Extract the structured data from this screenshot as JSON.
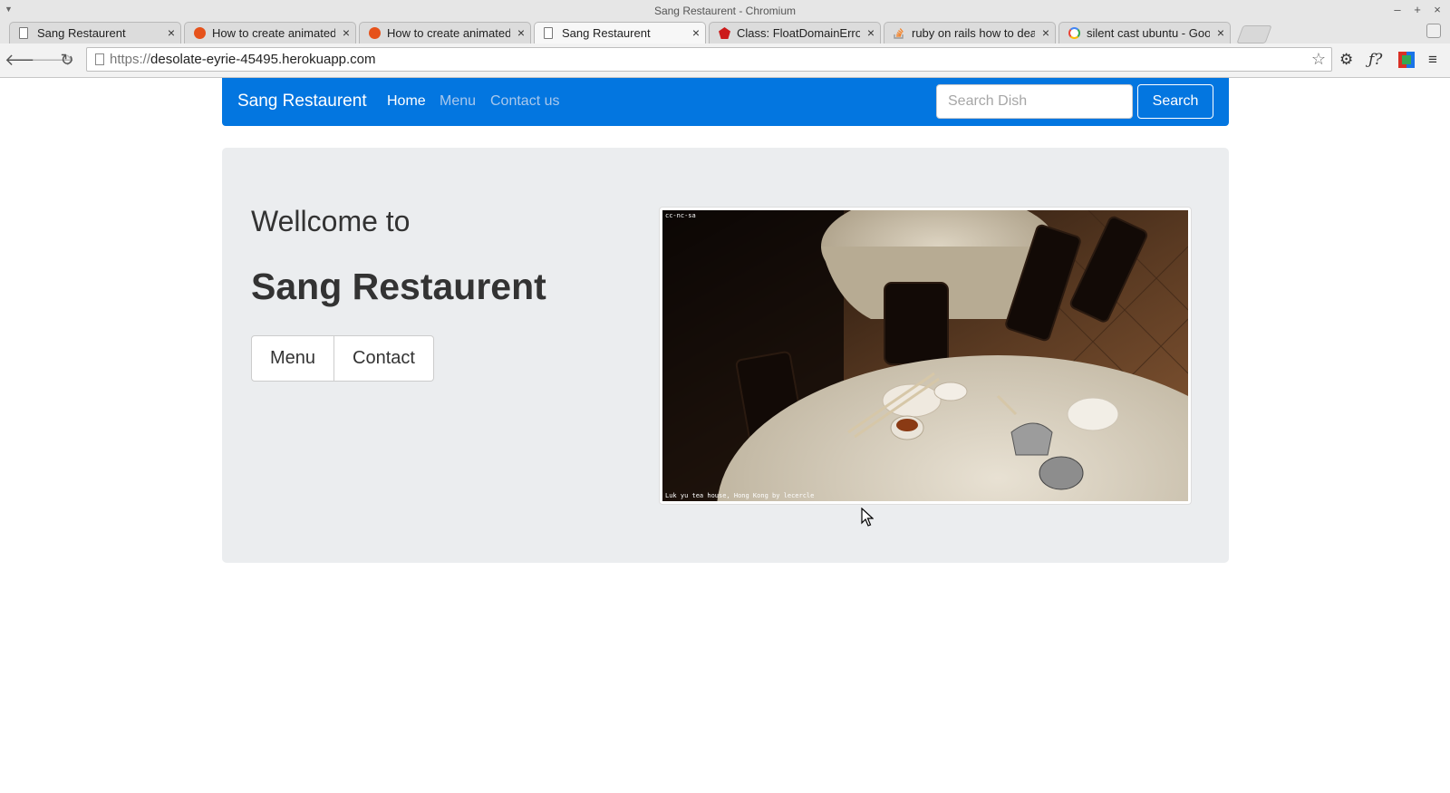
{
  "window": {
    "title": "Sang Restaurent - Chromium"
  },
  "tabs": [
    {
      "label": "Sang Restaurent",
      "icon": "page-icon",
      "active": false
    },
    {
      "label": "How to create animated",
      "icon": "askubuntu-icon",
      "active": false
    },
    {
      "label": "How to create animated",
      "icon": "askubuntu-icon",
      "active": false
    },
    {
      "label": "Sang Restaurent",
      "icon": "page-icon",
      "active": true
    },
    {
      "label": "Class: FloatDomainError",
      "icon": "ruby-icon",
      "active": false
    },
    {
      "label": "ruby on rails how to dea",
      "icon": "stackoverflow-icon",
      "active": false
    },
    {
      "label": "silent cast ubuntu - Goo",
      "icon": "google-icon",
      "active": false
    }
  ],
  "address_bar": {
    "scheme": "https://",
    "host": "desolate-eyrie-45495.herokuapp.com"
  },
  "navbar": {
    "brand": "Sang Restaurent",
    "links": [
      "Home",
      "Menu",
      "Contact us"
    ],
    "search_placeholder": "Search Dish",
    "search_button": "Search",
    "color": "#0376e0"
  },
  "hero": {
    "welcome": "Wellcome to",
    "name": "Sang Restaurent",
    "buttons": [
      "Menu",
      "Contact"
    ]
  },
  "photo": {
    "license": "cc-nc-sa",
    "caption": "Luk yu tea house, Hong Kong by lecercle"
  }
}
